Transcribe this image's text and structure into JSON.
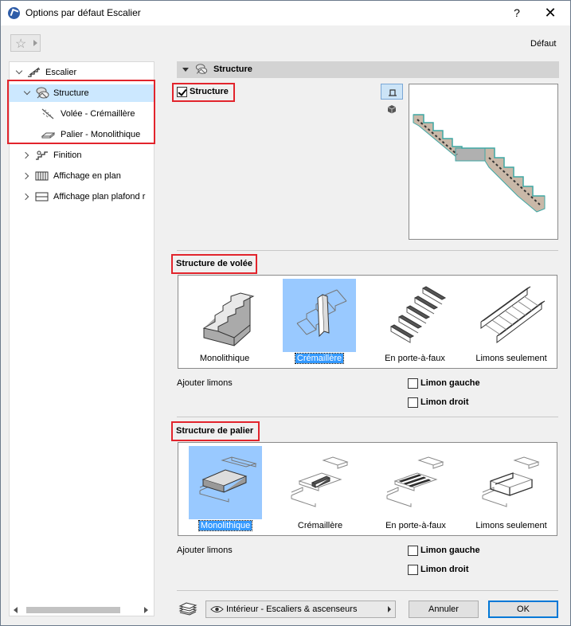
{
  "window": {
    "title": "Options par défaut Escalier",
    "help": "?",
    "close": "✕"
  },
  "header": {
    "favorites_icon": "star-icon",
    "preset_label": "Défaut"
  },
  "tree": {
    "items": [
      {
        "label": "Escalier",
        "icon": "stair-icon",
        "expanded": true
      },
      {
        "label": "Structure",
        "icon": "structure-icon",
        "expanded": true,
        "selected": true
      },
      {
        "label": "Volée - Crémaillère",
        "icon": "flight-icon"
      },
      {
        "label": "Palier - Monolithique",
        "icon": "landing-icon"
      },
      {
        "label": "Finition",
        "icon": "finish-icon",
        "expanded": false
      },
      {
        "label": "Affichage en plan",
        "icon": "plan-display-icon",
        "expanded": false
      },
      {
        "label": "Affichage plan plafond r",
        "icon": "ceiling-plan-icon",
        "expanded": false
      }
    ]
  },
  "panel": {
    "title": "Structure",
    "structure_checkbox": {
      "label": "Structure",
      "checked": true
    },
    "views": [
      "section-view-icon",
      "3d-view-icon"
    ]
  },
  "flight": {
    "title": "Structure de volée",
    "options": [
      "Monolithique",
      "Crémaillère",
      "En porte-à-faux",
      "Limons seulement"
    ],
    "selected_index": 1,
    "add_stringers": "Ajouter limons",
    "left_stringer": {
      "label": "Limon gauche",
      "checked": false
    },
    "right_stringer": {
      "label": "Limon droit",
      "checked": false
    }
  },
  "landing": {
    "title": "Structure de palier",
    "options": [
      "Monolithique",
      "Crémaillère",
      "En porte-à-faux",
      "Limons seulement"
    ],
    "selected_index": 0,
    "add_stringers": "Ajouter limons",
    "left_stringer": {
      "label": "Limon gauche",
      "checked": false
    },
    "right_stringer": {
      "label": "Limon droit",
      "checked": false
    }
  },
  "footer": {
    "layer": "Intérieur - Escaliers & ascenseurs",
    "cancel": "Annuler",
    "ok": "OK"
  },
  "colors": {
    "highlight_box": "#e2242c",
    "selection": "#99c9ff",
    "accent": "#0078d7"
  }
}
